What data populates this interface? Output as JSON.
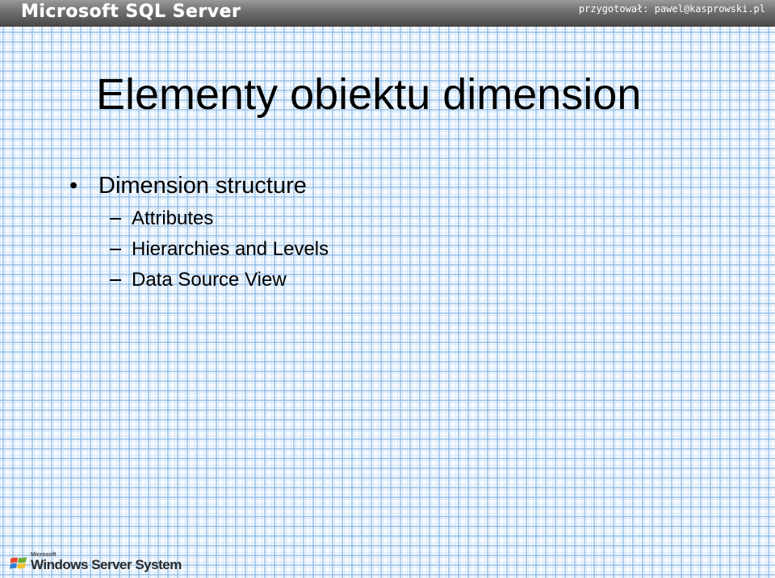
{
  "header": {
    "brand": "Microsoft SQL Server",
    "credit": "przygotował: pawel@kasprowski.pl"
  },
  "slide": {
    "title": "Elementy obiektu dimension",
    "bullets": [
      {
        "label": "Dimension structure",
        "children": [
          "Attributes",
          "Hierarchies and Levels",
          "Data Source View"
        ]
      }
    ]
  },
  "footer": {
    "logo_microsoft": "Microsoft",
    "logo_text": "Windows Server System"
  },
  "colors": {
    "header_bar": "#5e5e5e",
    "grid_line": "#78afe1",
    "background": "#f7fbff",
    "text": "#000000"
  },
  "icons": {
    "bullet": "bullet-dot",
    "sub_bullet": "dash",
    "footer_logo": "windows-flag-icon"
  }
}
